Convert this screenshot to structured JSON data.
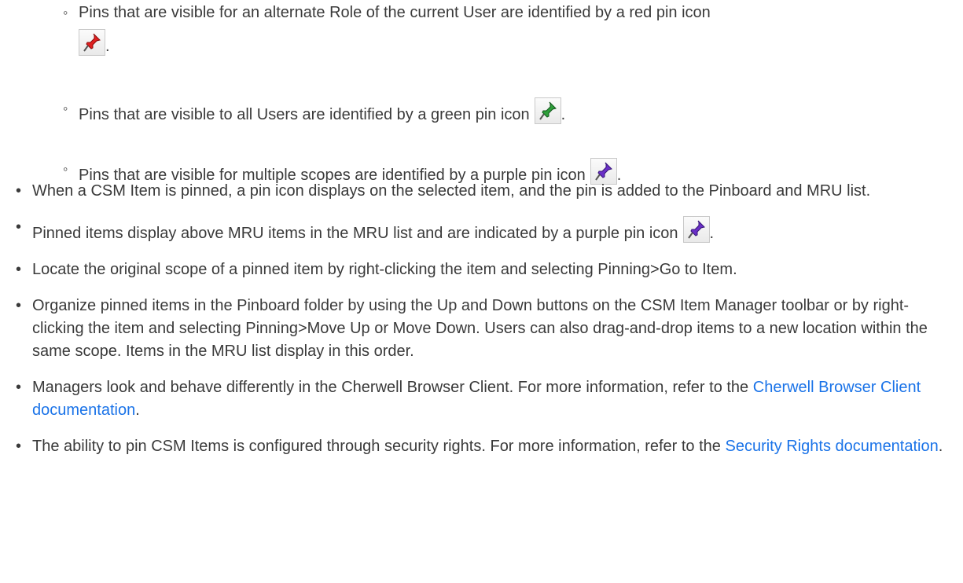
{
  "sub_items": [
    {
      "text": "Pins that are visible for an alternate Role of the current User are identified by a red pin icon",
      "icon": "red-pin-icon",
      "icon_color": "#e02020",
      "after": "."
    },
    {
      "text": "Pins that are visible to all Users are identified by a green pin icon",
      "icon": "green-pin-icon",
      "icon_color": "#2e9e3a",
      "after": "."
    },
    {
      "text": "Pins that are visible for multiple scopes are identified by a purple pin icon",
      "icon": "purple-pin-icon",
      "icon_color": "#6a2fc7",
      "after": "."
    }
  ],
  "main_items": {
    "item0": "When a CSM Item is pinned, a pin icon displays on the selected item, and the pin is added to the Pinboard and MRU list.",
    "item1_text": "Pinned items display above MRU items in the MRU list and are indicated by a purple pin icon",
    "item1_after": ".",
    "item2": "Locate the original scope of a pinned item by right-clicking the item and selecting Pinning>Go to Item.",
    "item3": "Organize pinned items in the Pinboard folder by using the Up and Down buttons on the CSM Item Manager toolbar or by right-clicking the item and selecting Pinning>Move Up or Move Down. Users can also drag-and-drop items to a new location within the same scope. Items in the MRU list display in this order.",
    "item4_text": "Managers look and behave differently in the Cherwell Browser Client. For more information, refer to the",
    "item4_link": "Cherwell Browser Client documentation",
    "item4_after": ".",
    "item5_text": "The ability to pin CSM Items is configured through security rights. For more information, refer to the",
    "item5_link": "Security Rights documentation",
    "item5_after": "."
  },
  "colors": {
    "text": "#3a3a3a",
    "link": "#1a73e8"
  }
}
